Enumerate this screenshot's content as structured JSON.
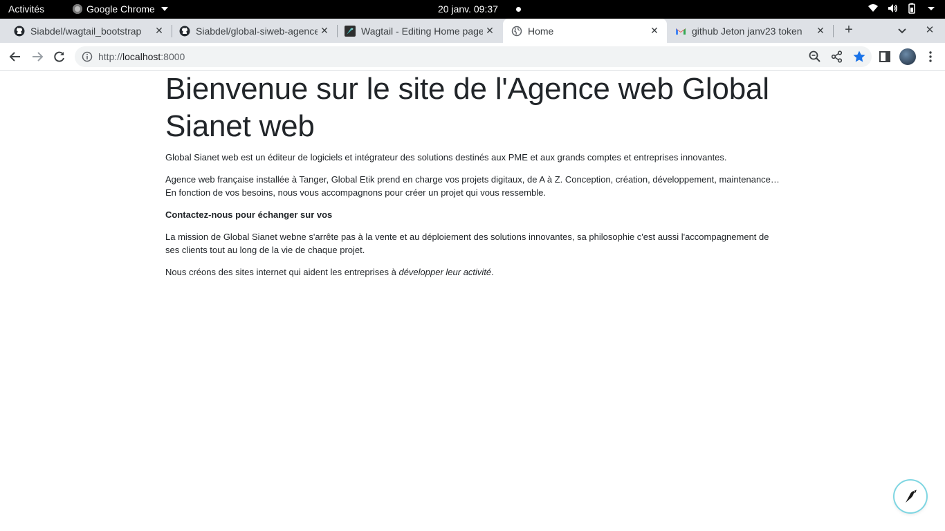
{
  "topbar": {
    "activities": "Activités",
    "app_name": "Google Chrome",
    "clock": "20 janv.  09:37"
  },
  "tabs": [
    {
      "title": "Siabdel/wagtail_bootstrap",
      "icon": "github-icon",
      "close": "✕"
    },
    {
      "title": "Siabdel/global-siweb-agence",
      "icon": "github-icon",
      "close": "✕"
    },
    {
      "title": "Wagtail - Editing Home page",
      "icon": "wagtail-icon",
      "close": "✕"
    },
    {
      "title": "Home",
      "icon": "globe-icon",
      "close": "✕",
      "active": true
    },
    {
      "title": "github Jeton janv23 token",
      "icon": "gmail-icon",
      "close": "✕"
    }
  ],
  "tabstrip": {
    "new_tab": "+",
    "window_close": "✕"
  },
  "toolbar": {
    "url_prefix": "http://",
    "url_host": "localhost",
    "url_port": ":8000"
  },
  "page": {
    "heading": "Bienvenue sur le site de l'Agence web Global Sianet web",
    "paragraphs": [
      "Global Sianet web est un éditeur de logiciels et intégrateur des solutions destinés aux PME et aux grands comptes et entreprises innovantes.",
      "Agence web française installée à Tanger, Global Etik prend en charge vos projets digitaux, de A à Z. Conception, création, développement, maintenance… En fonction de vos besoins, nous vous accompagnons pour créer un projet qui vous ressemble.",
      "Contactez-nous pour échanger sur vos",
      "La mission de Global Sianet webne s'arrête pas à la vente et au déploiement des solutions innovantes, sa philosophie c'est aussi l'accompagnement de ses clients tout au long de la vie de chaque projet."
    ],
    "last_para_prefix": "Nous créons des sites internet qui aident les entreprises à ",
    "last_para_em": "développer leur activité",
    "last_para_suffix": "."
  },
  "colors": {
    "tabstrip_bg": "#dee1e6",
    "bookmark_star": "#1a73e8",
    "wagtail_ring": "#7fd6e2"
  }
}
